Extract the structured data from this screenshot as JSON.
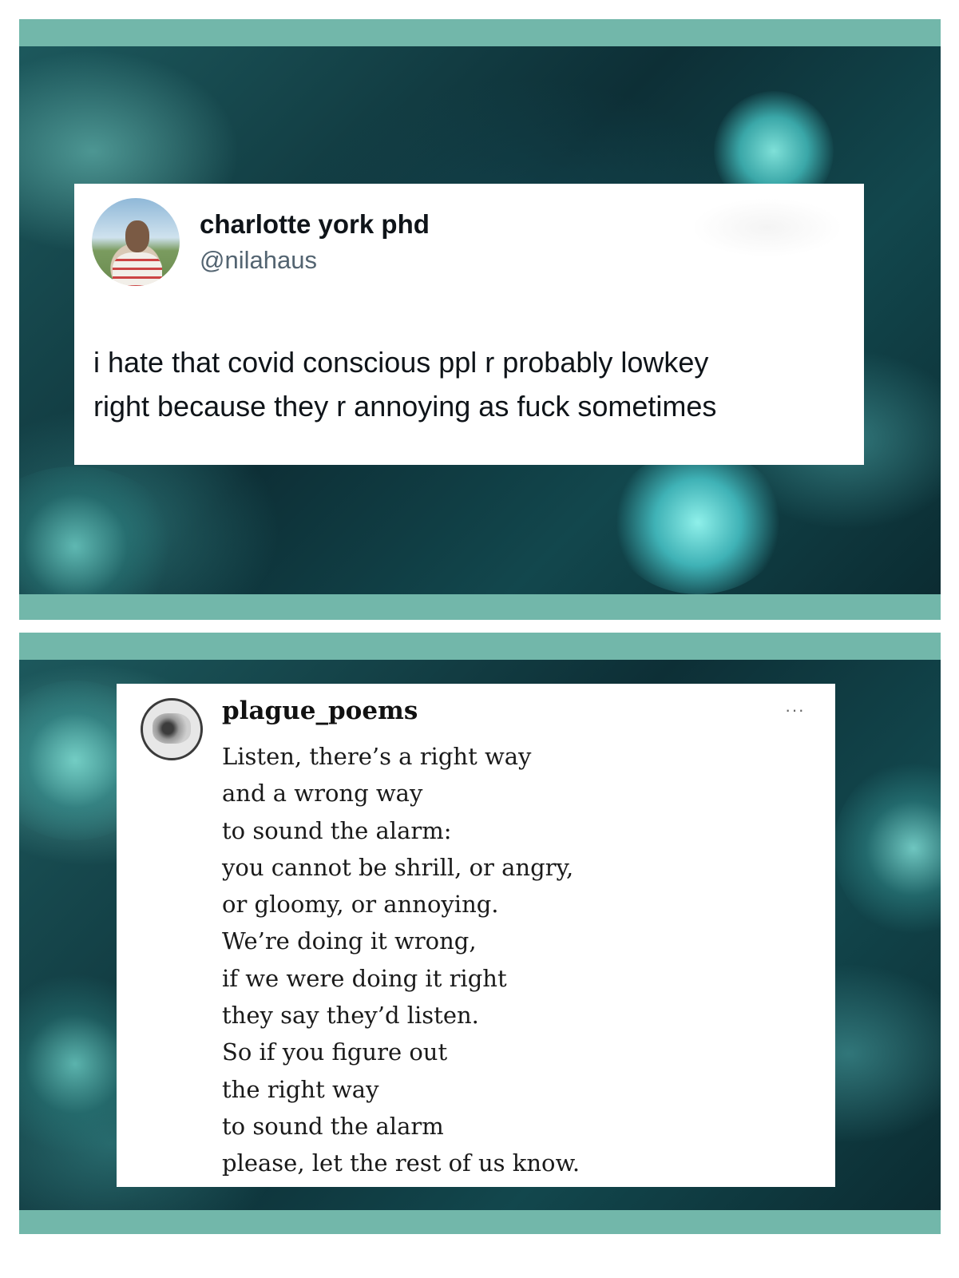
{
  "tweet": {
    "display_name": "charlotte york phd",
    "handle": "@nilahaus",
    "text_lines": [
      "i hate that covid conscious ppl r probably lowkey",
      "right because they r annoying as fuck sometimes"
    ]
  },
  "poem_post": {
    "username": "plague_poems",
    "more_icon": "···",
    "lines": [
      "Listen, there’s a right way",
      "and a wrong way",
      "to sound the alarm:",
      "you cannot be shrill, or angry,",
      "or gloomy, or annoying.",
      "We’re doing it wrong,",
      "if we were doing it right",
      "they say they’d listen.",
      "So if you figure out",
      "the right way",
      "to sound the alarm",
      "please, let the rest of us know."
    ]
  },
  "colors": {
    "frame_bar": "#72b7aa",
    "background_dark": "#0d2f36",
    "handle_gray": "#536471"
  }
}
